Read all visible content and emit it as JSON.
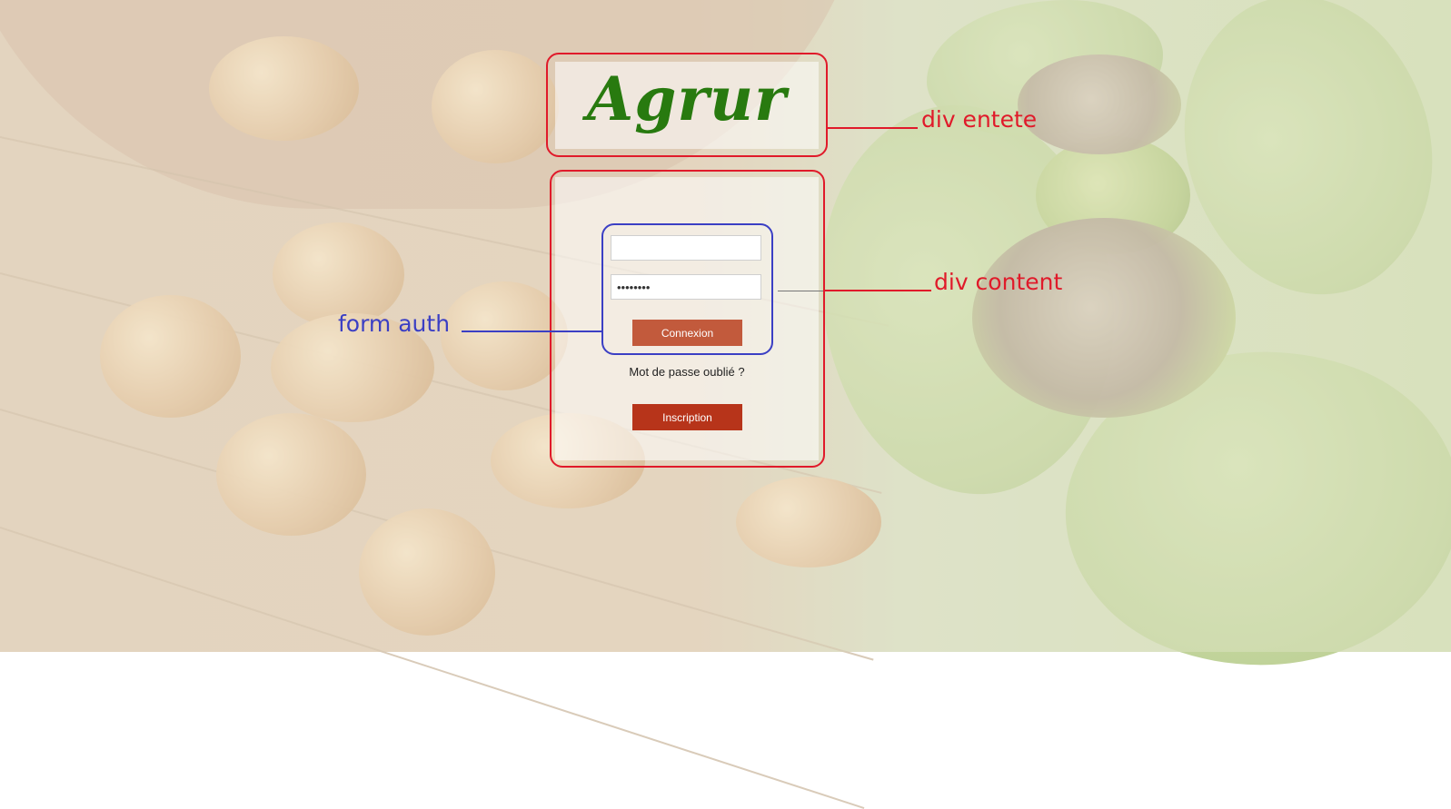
{
  "header": {
    "title": "Agrur"
  },
  "form": {
    "login_value": "",
    "password_value": "••••••••",
    "submit_label": "Connexion",
    "forgot_label": "Mot de passe oublié ?",
    "register_label": "Inscription"
  },
  "annotations": {
    "entete": "div entete",
    "content": "div content",
    "form": "form auth"
  },
  "colors": {
    "title": "#287a0f",
    "connexion_button": "#c25a3c",
    "inscription_button": "#b7341a",
    "annotation_red": "#e01a2a",
    "annotation_blue": "#3b3fc4"
  }
}
